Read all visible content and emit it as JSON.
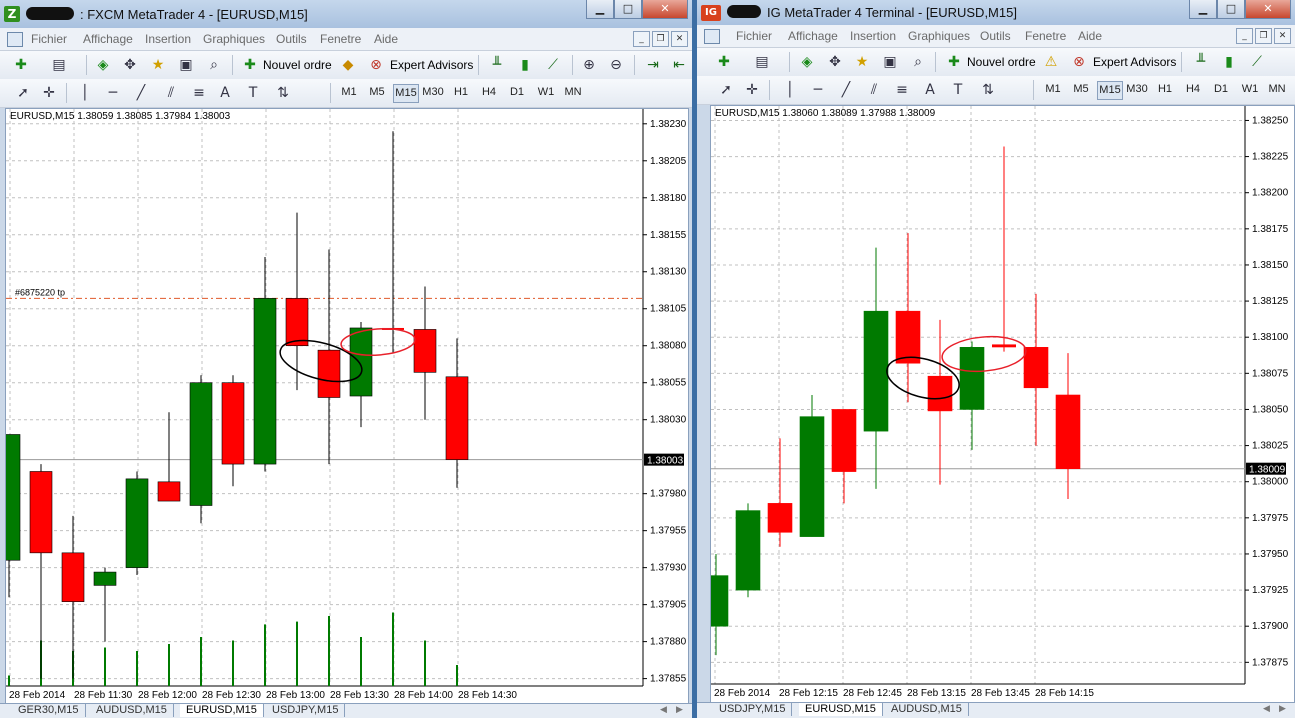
{
  "windows": [
    {
      "id": "left",
      "app_icon_text": "Z",
      "app_icon_color": "#2f8f1f",
      "title": ": FXCM MetaTrader 4 - [EURUSD,M15]",
      "menu": [
        "Fichier",
        "Affichage",
        "Insertion",
        "Graphiques",
        "Outils",
        "Fenetre",
        "Aide"
      ],
      "new_order_label": "Nouvel ordre",
      "expert_advisors_label": "Expert Advisors",
      "timeframes": [
        "M1",
        "M5",
        "M15",
        "M30",
        "H1",
        "H4",
        "D1",
        "W1",
        "MN"
      ],
      "active_timeframe": "M15",
      "chart_header": "EURUSD,M15  1.38059 1.38085 1.37984 1.38003",
      "order_label": "#6875220 tp",
      "current_price": "1.38003",
      "tabs": [
        "GER30,M15",
        "AUDUSD,M15",
        "EURUSD,M15",
        "USDJPY,M15"
      ],
      "active_tab": "EURUSD,M15"
    },
    {
      "id": "right",
      "app_icon_text": "IG",
      "app_icon_color": "#d8411d",
      "title": "IG MetaTrader 4 Terminal - [EURUSD,M15]",
      "menu": [
        "Fichier",
        "Affichage",
        "Insertion",
        "Graphiques",
        "Outils",
        "Fenetre",
        "Aide"
      ],
      "new_order_label": "Nouvel ordre",
      "expert_advisors_label": "Expert Advisors",
      "timeframes": [
        "M1",
        "M5",
        "M15",
        "M30",
        "H1",
        "H4",
        "D1",
        "W1",
        "MN"
      ],
      "active_timeframe": "M15",
      "chart_header": "EURUSD,M15  1.38060 1.38089 1.37988 1.38009",
      "current_price": "1.38009",
      "tabs": [
        "USDJPY,M15",
        "EURUSD,M15",
        "AUDUSD,M15"
      ],
      "active_tab": "EURUSD,M15"
    }
  ],
  "colors": {
    "bull": "#007a00",
    "bear": "#ff0000",
    "grid": "#c0c0c0",
    "order_line": "#e05a2b",
    "annotation_black": "#000000",
    "annotation_red": "#e8202a"
  },
  "chart_data": [
    {
      "type": "candlestick",
      "symbol": "EURUSD,M15",
      "source": "FXCM MetaTrader 4",
      "y_ticks": [
        "1.38230",
        "1.38205",
        "1.38180",
        "1.38155",
        "1.38130",
        "1.38105",
        "1.38080",
        "1.38055",
        "1.38030",
        "1.38003",
        "1.37980",
        "1.37955",
        "1.37930",
        "1.37905",
        "1.37880",
        "1.37855"
      ],
      "x_ticks": [
        "28 Feb 2014",
        "28 Feb 11:30",
        "28 Feb 12:00",
        "28 Feb 12:30",
        "28 Feb 13:00",
        "28 Feb 13:30",
        "28 Feb 14:00",
        "28 Feb 14:30"
      ],
      "ylim": [
        1.3785,
        1.3824
      ],
      "order_line_price": 1.38112,
      "candles": [
        {
          "open": 1.37935,
          "high": 1.3801,
          "low": 1.3791,
          "close": 1.3802
        },
        {
          "open": 1.37995,
          "high": 1.38,
          "low": 1.37855,
          "close": 1.3794
        },
        {
          "open": 1.3794,
          "high": 1.37965,
          "low": 1.37855,
          "close": 1.37907
        },
        {
          "open": 1.37918,
          "high": 1.3793,
          "low": 1.3788,
          "close": 1.37927
        },
        {
          "open": 1.3793,
          "high": 1.37995,
          "low": 1.37925,
          "close": 1.3799
        },
        {
          "open": 1.37988,
          "high": 1.38035,
          "low": 1.3798,
          "close": 1.37975
        },
        {
          "open": 1.37972,
          "high": 1.3806,
          "low": 1.3796,
          "close": 1.38055
        },
        {
          "open": 1.38055,
          "high": 1.3806,
          "low": 1.37985,
          "close": 1.38
        },
        {
          "open": 1.38,
          "high": 1.3814,
          "low": 1.37995,
          "close": 1.38112
        },
        {
          "open": 1.38112,
          "high": 1.3817,
          "low": 1.3805,
          "close": 1.3808
        },
        {
          "open": 1.38077,
          "high": 1.38145,
          "low": 1.38,
          "close": 1.38045
        },
        {
          "open": 1.38046,
          "high": 1.38096,
          "low": 1.38025,
          "close": 1.38092
        },
        {
          "open": 1.38092,
          "high": 1.38225,
          "low": 1.38075,
          "close": 1.38092
        },
        {
          "open": 1.38091,
          "high": 1.3812,
          "low": 1.3803,
          "close": 1.38062
        },
        {
          "open": 1.38059,
          "high": 1.38085,
          "low": 1.37984,
          "close": 1.38003
        }
      ],
      "volumes": [
        0.15,
        0.65,
        0.5,
        0.55,
        0.5,
        0.6,
        0.7,
        0.65,
        0.88,
        0.92,
        1.0,
        0.7,
        1.05,
        0.65,
        0.3
      ]
    },
    {
      "type": "candlestick",
      "symbol": "EURUSD,M15",
      "source": "IG MetaTrader 4 Terminal",
      "y_ticks": [
        "1.38250",
        "1.38225",
        "1.38200",
        "1.38175",
        "1.38150",
        "1.38125",
        "1.38100",
        "1.38075",
        "1.38050",
        "1.38025",
        "1.38009",
        "1.38000",
        "1.37975",
        "1.37950",
        "1.37925",
        "1.37900",
        "1.37875"
      ],
      "x_ticks": [
        "28 Feb 2014",
        "28 Feb 12:15",
        "28 Feb 12:45",
        "28 Feb 13:15",
        "28 Feb 13:45",
        "28 Feb 14:15"
      ],
      "ylim": [
        1.3786,
        1.3826
      ],
      "candles": [
        {
          "open": 1.379,
          "high": 1.3795,
          "low": 1.3788,
          "close": 1.37935
        },
        {
          "open": 1.37925,
          "high": 1.37985,
          "low": 1.3792,
          "close": 1.3798
        },
        {
          "open": 1.37985,
          "high": 1.3803,
          "low": 1.37955,
          "close": 1.37965
        },
        {
          "open": 1.37962,
          "high": 1.3806,
          "low": 1.37962,
          "close": 1.38045
        },
        {
          "open": 1.3805,
          "high": 1.3805,
          "low": 1.37985,
          "close": 1.38007
        },
        {
          "open": 1.38035,
          "high": 1.38162,
          "low": 1.37995,
          "close": 1.38118
        },
        {
          "open": 1.38118,
          "high": 1.38172,
          "low": 1.38055,
          "close": 1.38082
        },
        {
          "open": 1.38073,
          "high": 1.38112,
          "low": 1.37998,
          "close": 1.38049
        },
        {
          "open": 1.3805,
          "high": 1.38097,
          "low": 1.38022,
          "close": 1.38093
        },
        {
          "open": 1.38095,
          "high": 1.38232,
          "low": 1.3809,
          "close": 1.38093
        },
        {
          "open": 1.38093,
          "high": 1.3813,
          "low": 1.38025,
          "close": 1.38065
        },
        {
          "open": 1.3806,
          "high": 1.38089,
          "low": 1.37988,
          "close": 1.38009
        }
      ]
    }
  ]
}
